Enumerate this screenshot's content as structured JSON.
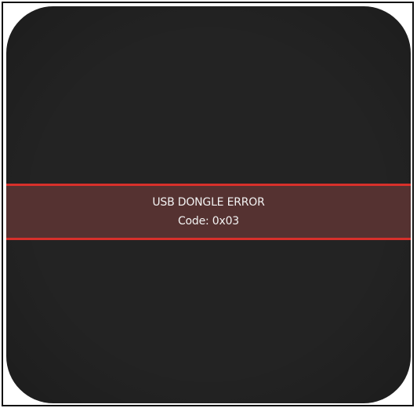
{
  "error": {
    "title": "USB DONGLE ERROR",
    "code": "Code: 0x03"
  },
  "colors": {
    "screen_background": "#232323",
    "banner_fill": "#553231",
    "banner_border": "#d8302b",
    "text": "#f3f3f3"
  }
}
